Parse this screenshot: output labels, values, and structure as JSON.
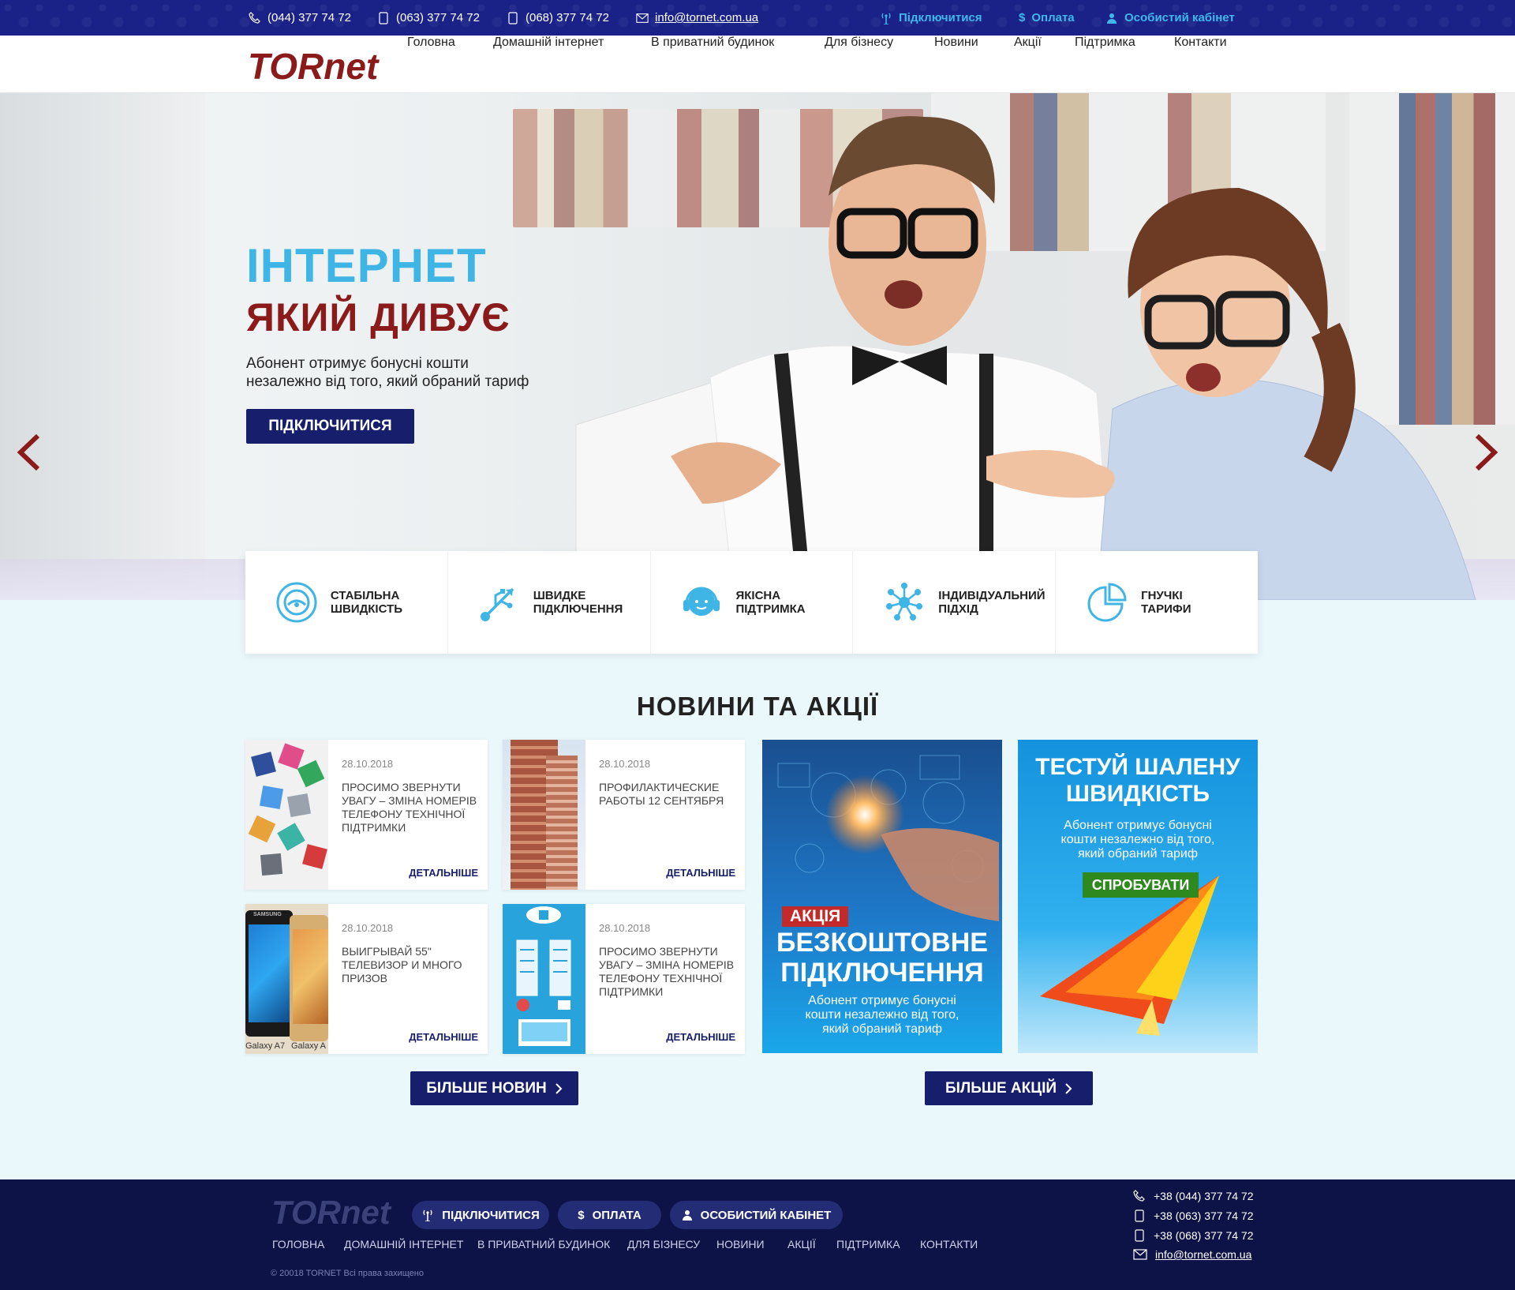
{
  "topbar": {
    "phone1": "(044) 377 74 72",
    "phone2": "(063) 377 74 72",
    "phone3": "(068) 377 74 72",
    "email": "info@tornet.com.ua",
    "connect": "Підключитися",
    "payment": "Оплата",
    "cabinet": "Особистий кабінет"
  },
  "logo": {
    "text": "TORnet"
  },
  "nav": [
    "Головна",
    "Домашній інтернет",
    "В приватний будинок",
    "Для бізнесу",
    "Новини",
    "Акції",
    "Підтримка",
    "Контакти"
  ],
  "hero": {
    "title1": "ІНТЕРНЕТ",
    "title2": "ЯКИЙ ДИВУЄ",
    "text": "Абонент отримує бонусні кошти незалежно від того, який обраний тариф",
    "button": "ПІДКЛЮЧИТИСЯ"
  },
  "features": [
    {
      "label": "Стабільна швидкість",
      "icon": "speedometer-icon"
    },
    {
      "label": "Швидке підключення",
      "icon": "usb-icon"
    },
    {
      "label": "Якісна підтримка",
      "icon": "headset-icon"
    },
    {
      "label": "Індивідуальний підхід",
      "icon": "network-icon"
    },
    {
      "label": "Гнучкі тарифи",
      "icon": "pie-chart-icon"
    }
  ],
  "news": {
    "title": "НОВИНИ ТА АКЦІЇ",
    "items": [
      {
        "date": "28.10.2018",
        "title": "Просимо звернути увагу – зміна номерів телефону технічної підтримки",
        "more": "ДЕТАЛЬНІШЕ"
      },
      {
        "date": "28.10.2018",
        "title": "Профилактические работы 12 сентября",
        "more": "ДЕТАЛЬНІШЕ"
      },
      {
        "date": "28.10.2018",
        "title": "Выигрывай 55\" телевизор и много призов",
        "more": "ДЕТАЛЬНІШЕ"
      },
      {
        "date": "28.10.2018",
        "title": "Просимо звернути увагу – зміна номерів телефону технічної підтримки",
        "more": "ДЕТАЛЬНІШЕ"
      }
    ],
    "phone_labels": [
      "Galaxy A7",
      "Galaxy A"
    ],
    "phone_brand": "SAMSUNG",
    "more_news": "БІЛЬШЕ НОВИН",
    "more_promos": "БІЛЬШЕ АКЦІЙ"
  },
  "promo1": {
    "tag": "АКЦІЯ",
    "title": "БЕЗКОШТОВНЕ ПІДКЛЮЧЕННЯ",
    "text": "Абонент отримує бонусні кошти незалежно від того, який обраний тариф"
  },
  "promo2": {
    "title": "ТЕСТУЙ ШАЛЕНУ ШВИДКІСТЬ",
    "text": "Абонент отримує бонусні кошти незалежно від того, який обраний тариф",
    "button": "СПРОБУВАТИ"
  },
  "footer": {
    "connect": "ПІДКЛЮЧИТИСЯ",
    "payment": "ОПЛАТА",
    "cabinet": "ОСОБИСТИЙ КАБІНЕТ",
    "links": [
      "ГОЛОВНА",
      "ДОМАШНІЙ ІНТЕРНЕТ",
      "В ПРИВАТНИЙ БУДИНОК",
      "ДЛЯ БІЗНЕСУ",
      "НОВИНИ",
      "АКЦІЇ",
      "ПІДТРИМКА",
      "КОНТАКТИ"
    ],
    "copyright": "© 20018 TORNET Всі права захищено",
    "phone1": "+38 (044) 377 74 72",
    "phone2": "+38 (063) 377 74 72",
    "phone3": "+38 (068) 377 74 72",
    "email": "info@tornet.com.ua"
  },
  "colors": {
    "navy": "#171e6b",
    "accent_blue": "#3fb5e6",
    "brand_red": "#8b1a1a",
    "topbar": "#1a2288",
    "footer": "#0d1347"
  }
}
